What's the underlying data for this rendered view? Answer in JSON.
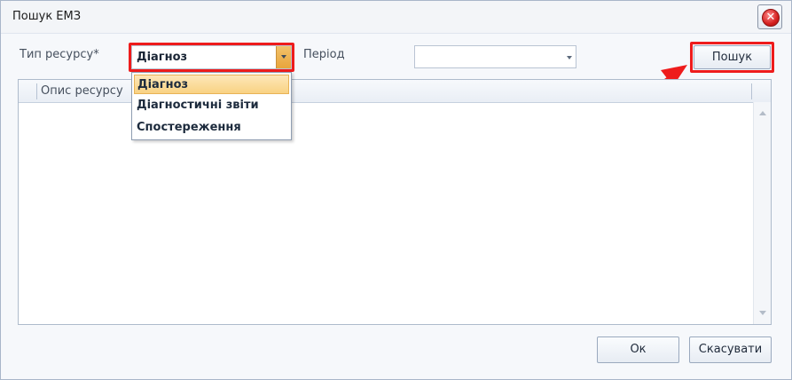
{
  "window": {
    "title": "Пошук ЕМЗ"
  },
  "form": {
    "resource_type_label": "Тип ресурсу*",
    "resource_type_value": "Діагноз",
    "period_label": "Період",
    "period_value": "",
    "search_button": "Пошук"
  },
  "dropdown": {
    "options": [
      "Діагноз",
      "Діагностичні звіти",
      "Спостереження"
    ],
    "selected": "Діагноз"
  },
  "grid": {
    "columns": [
      "Опис ресурсу"
    ],
    "rows": []
  },
  "footer": {
    "ok_button": "Ок",
    "cancel_button": "Скасувати"
  },
  "icons": {
    "close": "close-icon",
    "dropdown_arrow": "chevron-down-icon"
  },
  "colors": {
    "highlight": "#ee1c1c",
    "selected_item": "#f9d283",
    "combo_accent": "#e8a53c"
  }
}
